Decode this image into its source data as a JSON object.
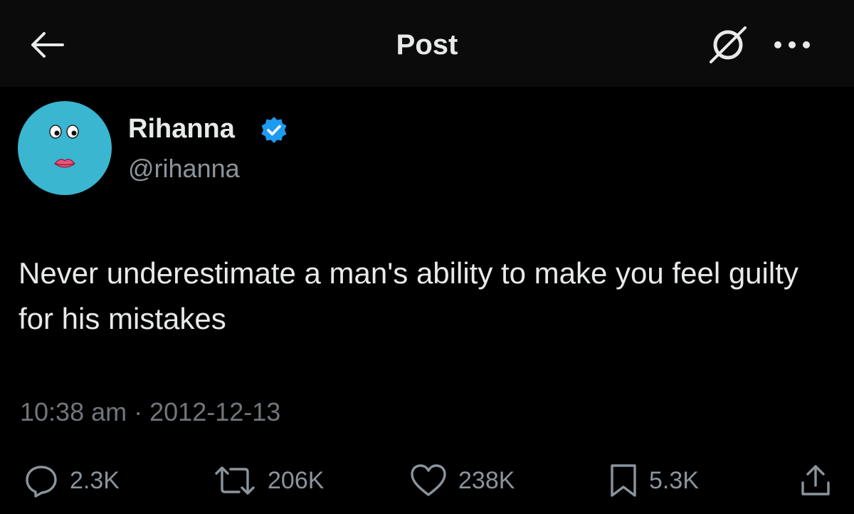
{
  "header": {
    "title": "Post",
    "back_icon": "arrow-left-icon",
    "grok_icon": "grok-icon",
    "more_icon": "more-horizontal-icon"
  },
  "post": {
    "author": {
      "name": "Rihanna",
      "handle": "@rihanna",
      "verified": true,
      "avatar_color": "#3ab6d0",
      "badge_color": "#1d9bf0"
    },
    "text": "Never underestimate a man's ability to make you feel guilty for his mistakes",
    "time": "10:38 am",
    "separator": "·",
    "date": "2012-12-13"
  },
  "actions": {
    "replies": "2.3K",
    "reposts": "206K",
    "likes": "238K",
    "bookmarks": "5.3K"
  },
  "colors": {
    "background": "#000000",
    "header_background": "#0b0b0b",
    "text_primary": "#e7e9ea",
    "text_secondary": "#71767b"
  }
}
